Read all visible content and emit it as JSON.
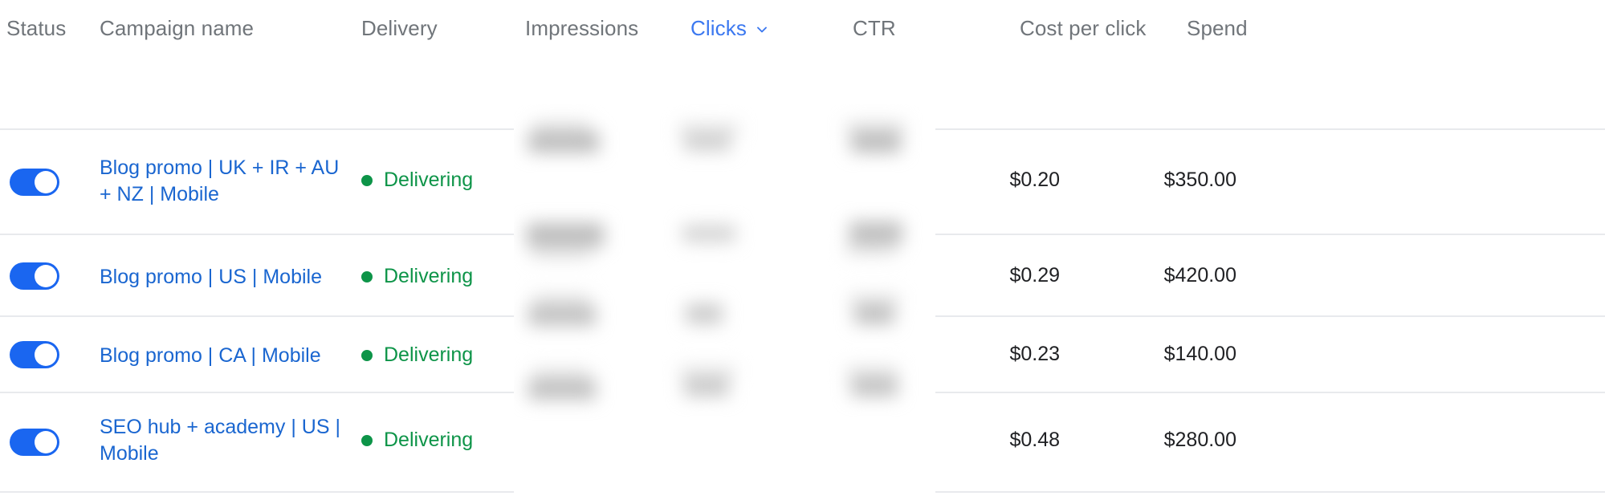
{
  "table": {
    "columns": [
      {
        "key": "status",
        "label": "Status",
        "sorted": false,
        "align": "left"
      },
      {
        "key": "name",
        "label": "Campaign name",
        "sorted": false,
        "align": "left"
      },
      {
        "key": "delivery",
        "label": "Delivery",
        "sorted": false,
        "align": "left"
      },
      {
        "key": "impressions",
        "label": "Impressions",
        "sorted": false,
        "align": "left"
      },
      {
        "key": "clicks",
        "label": "Clicks",
        "sorted": true,
        "align": "left"
      },
      {
        "key": "ctr",
        "label": "CTR",
        "sorted": false,
        "align": "left"
      },
      {
        "key": "cpc",
        "label": "Cost per click",
        "sorted": false,
        "align": "left"
      },
      {
        "key": "spend",
        "label": "Spend",
        "sorted": false,
        "align": "left"
      }
    ],
    "sort": {
      "column": "Clicks",
      "icon": "chevron-down-icon"
    },
    "rows": [
      {
        "toggle": "on",
        "name": "Blog promo | UK + IR + AU + NZ | Mobile",
        "delivery": "Delivering",
        "delivery_dot": "green-status-dot",
        "impressions": "",
        "clicks": "",
        "ctr": "",
        "cpc": "$0.20",
        "spend": "$350.00"
      },
      {
        "toggle": "on",
        "name": "Blog promo | US | Mobile",
        "delivery": "Delivering",
        "delivery_dot": "green-status-dot",
        "impressions": "",
        "clicks": "",
        "ctr": "",
        "cpc": "$0.29",
        "spend": "$420.00"
      },
      {
        "toggle": "on",
        "name": "Blog promo | CA | Mobile",
        "delivery": "Delivering",
        "delivery_dot": "green-status-dot",
        "impressions": "",
        "clicks": "",
        "ctr": "",
        "cpc": "$0.23",
        "spend": "$140.00"
      },
      {
        "toggle": "on",
        "name": "SEO hub + academy | US | Mobile",
        "delivery": "Delivering",
        "delivery_dot": "green-status-dot",
        "impressions": "",
        "clicks": "",
        "ctr": "",
        "cpc": "$0.48",
        "spend": "$280.00"
      }
    ],
    "redacted_columns": [
      "Impressions",
      "Clicks",
      "CTR"
    ]
  },
  "colors": {
    "header_text": "#70757a",
    "sorted_header": "#3b78f0",
    "link": "#1a66d0",
    "toggle_on": "#1a66f0",
    "delivering": "#0d9448",
    "value_text": "#202124",
    "row_divider": "#e8eaed",
    "background": "#ffffff"
  }
}
